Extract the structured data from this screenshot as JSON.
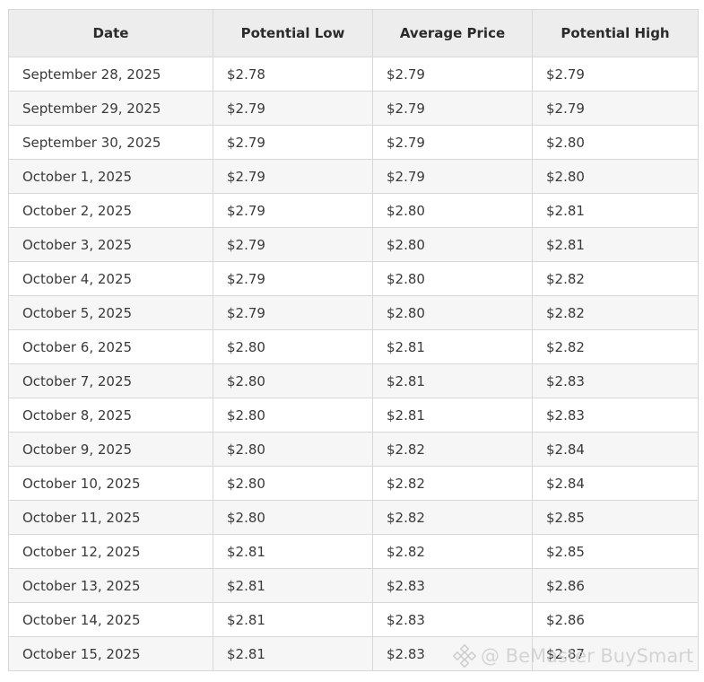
{
  "table": {
    "headers": [
      "Date",
      "Potential Low",
      "Average Price",
      "Potential High"
    ],
    "rows": [
      [
        "September 28, 2025",
        "$2.78",
        "$2.79",
        "$2.79"
      ],
      [
        "September 29, 2025",
        "$2.79",
        "$2.79",
        "$2.79"
      ],
      [
        "September 30, 2025",
        "$2.79",
        "$2.79",
        "$2.80"
      ],
      [
        "October 1, 2025",
        "$2.79",
        "$2.79",
        "$2.80"
      ],
      [
        "October 2, 2025",
        "$2.79",
        "$2.80",
        "$2.81"
      ],
      [
        "October 3, 2025",
        "$2.79",
        "$2.80",
        "$2.81"
      ],
      [
        "October 4, 2025",
        "$2.79",
        "$2.80",
        "$2.82"
      ],
      [
        "October 5, 2025",
        "$2.79",
        "$2.80",
        "$2.82"
      ],
      [
        "October 6, 2025",
        "$2.80",
        "$2.81",
        "$2.82"
      ],
      [
        "October 7, 2025",
        "$2.80",
        "$2.81",
        "$2.83"
      ],
      [
        "October 8, 2025",
        "$2.80",
        "$2.81",
        "$2.83"
      ],
      [
        "October 9, 2025",
        "$2.80",
        "$2.82",
        "$2.84"
      ],
      [
        "October 10, 2025",
        "$2.80",
        "$2.82",
        "$2.84"
      ],
      [
        "October 11, 2025",
        "$2.80",
        "$2.82",
        "$2.85"
      ],
      [
        "October 12, 2025",
        "$2.81",
        "$2.82",
        "$2.85"
      ],
      [
        "October 13, 2025",
        "$2.81",
        "$2.83",
        "$2.86"
      ],
      [
        "October 14, 2025",
        "$2.81",
        "$2.83",
        "$2.86"
      ],
      [
        "October 15, 2025",
        "$2.81",
        "$2.83",
        "$2.87"
      ]
    ]
  },
  "watermark": {
    "text": "@ BeMaster BuySmart",
    "icon": "binance-logo-icon"
  },
  "colors": {
    "header_bg": "#ededed",
    "row_alt_bg": "#f6f6f6",
    "border": "#d8d8d8",
    "text": "#333333"
  }
}
